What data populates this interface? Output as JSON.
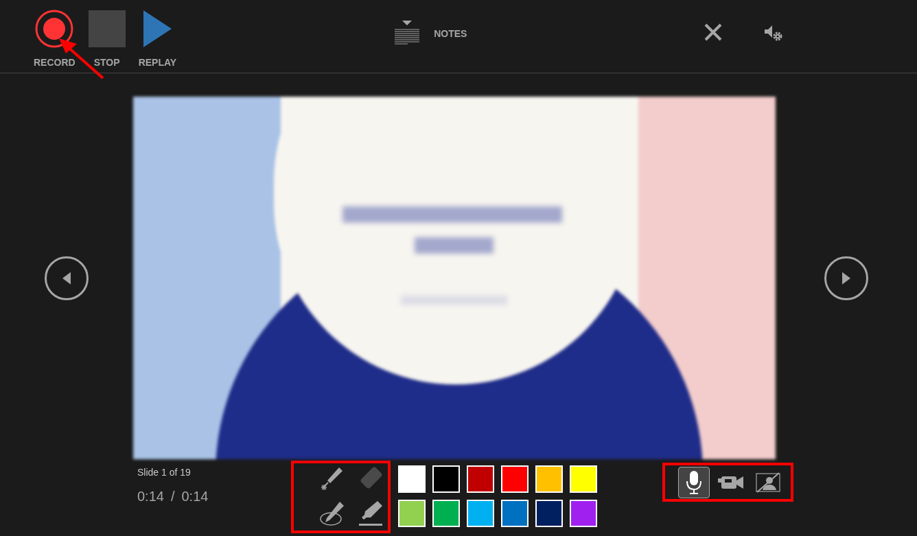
{
  "toolbar": {
    "buttons": [
      {
        "kind": "record",
        "label": "RECORD"
      },
      {
        "kind": "stop",
        "label": "STOP"
      },
      {
        "kind": "replay",
        "label": "REPLAY"
      }
    ],
    "notes": {
      "label": "NOTES"
    }
  },
  "slide_counter": "Slide 1 of 19",
  "timer": {
    "elapsed": "0:14",
    "separator": "/",
    "total": "0:14"
  },
  "pen_tools": [
    {
      "kind": "laser",
      "disabled": false
    },
    {
      "kind": "eraser",
      "disabled": true
    },
    {
      "kind": "pen",
      "disabled": false
    },
    {
      "kind": "highlighter",
      "disabled": false
    }
  ],
  "ink_colors": [
    {
      "color": "#ffffff"
    },
    {
      "color": "#000000"
    },
    {
      "color": "#c00000"
    },
    {
      "color": "#ff0000"
    },
    {
      "color": "#ffc000"
    },
    {
      "color": "#ffff00"
    },
    {
      "color": "#92d050"
    },
    {
      "color": "#00b050"
    },
    {
      "color": "#00b0f0"
    },
    {
      "color": "#0070c0"
    },
    {
      "color": "#002060"
    },
    {
      "color": "#a020f0"
    }
  ],
  "media_toggles": [
    {
      "kind": "microphone",
      "selected": true
    },
    {
      "kind": "camera",
      "selected": false
    },
    {
      "kind": "camera-preview",
      "selected": false
    }
  ]
}
